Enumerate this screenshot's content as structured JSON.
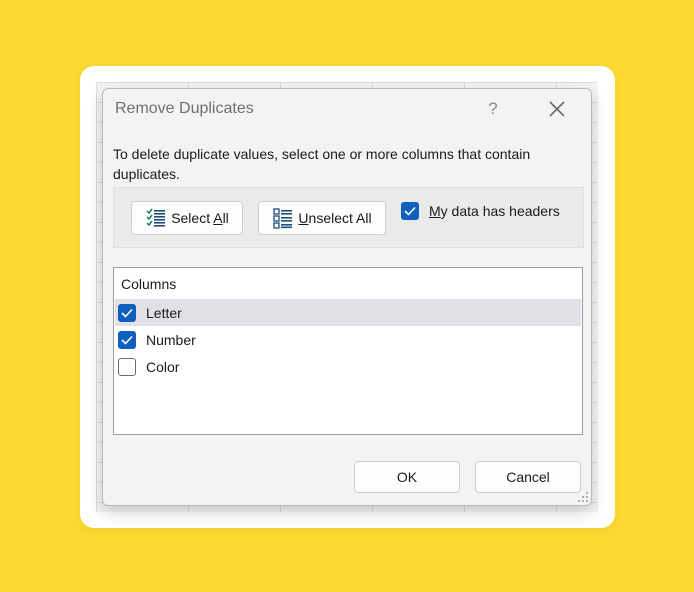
{
  "dialog": {
    "title": "Remove Duplicates",
    "help_label": "?",
    "description": "To delete duplicate values, select one or more columns that contain duplicates.",
    "select_all": {
      "before": "Select ",
      "mnemonic": "A",
      "after": "ll"
    },
    "unselect_all": {
      "mnemonic": "U",
      "after": "nselect All"
    },
    "headers_checkbox": {
      "mnemonic": "M",
      "after": "y data has headers",
      "checked": true
    },
    "columns_header": "Columns",
    "columns": [
      {
        "label": "Letter",
        "checked": true,
        "selected": true
      },
      {
        "label": "Number",
        "checked": true,
        "selected": false
      },
      {
        "label": "Color",
        "checked": false,
        "selected": false
      }
    ],
    "ok_label": "OK",
    "cancel_label": "Cancel"
  },
  "colors": {
    "background": "#FCD931",
    "checkbox_accent": "#0f5fbd",
    "icon_green": "#1d7a45",
    "icon_blue": "#1f4e79"
  },
  "icons": [
    "help-icon",
    "close-icon",
    "select-all-icon",
    "unselect-all-icon",
    "checkmark-icon",
    "resize-grip-icon"
  ]
}
